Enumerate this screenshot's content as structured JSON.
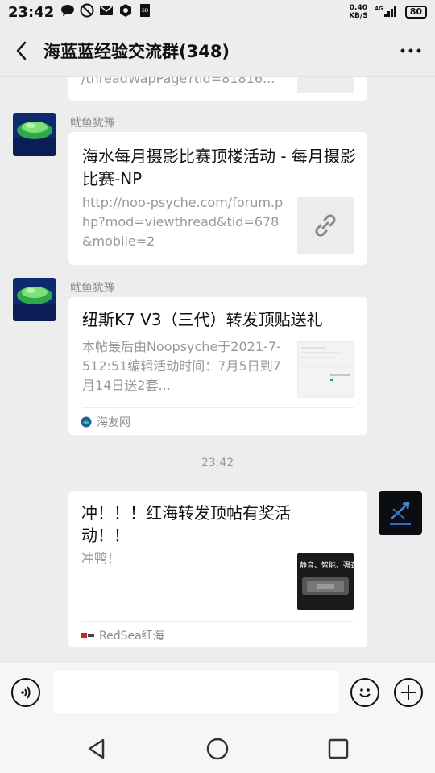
{
  "status_bar": {
    "time": "23:42",
    "net_speed_value": "0.40",
    "net_speed_unit": "KB/S",
    "signal": "4G",
    "battery": "80"
  },
  "header": {
    "title": "海蓝蓝经验交流群(348)"
  },
  "messages": [
    {
      "partial_desc": "/threadWapPage?tid=81816..."
    },
    {
      "sender": "鱿鱼犹豫",
      "title": "海水每月摄影比赛顶楼活动 - 每月摄影比赛-NP",
      "desc": "http://noo-psyche.com/forum.php?mod=viewthread&tid=678&mobile=2",
      "thumb_icon": "link-icon"
    },
    {
      "sender": "鱿鱼犹豫",
      "title": "纽斯K7 V3（三代）转发顶贴送礼",
      "desc": "本帖最后由Noopsyche于2021-7-512:51编辑活动时间：7月5日到7月14日送2套...",
      "source": "海友网"
    },
    {
      "timestamp": "23:42"
    },
    {
      "title": "冲！！！红海转发顶帖有奖活动！！",
      "desc": "冲鸭！",
      "thumb_text": "静音、智能、强劲",
      "source": "RedSea红海"
    }
  ],
  "colors": {
    "background": "#ededed",
    "card": "#ffffff",
    "muted_text": "#999999"
  }
}
